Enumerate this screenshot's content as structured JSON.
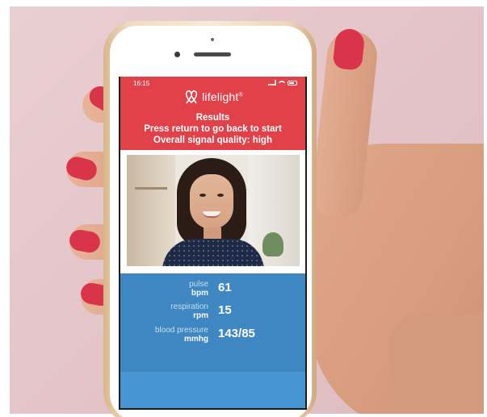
{
  "status_bar": {
    "time": "16:15"
  },
  "brand": {
    "name": "lifelight",
    "mark": "®",
    "logo_icon": "heart-loop-icon"
  },
  "header": {
    "title": "Results",
    "instruction": "Press return to go back to start",
    "signal_quality": "Overall signal quality: high"
  },
  "metrics": [
    {
      "label": "pulse",
      "unit": "bpm",
      "value": "61"
    },
    {
      "label": "respiration",
      "unit": "rpm",
      "value": "15"
    },
    {
      "label": "blood pressure",
      "unit": "mmhg",
      "value": "143/85"
    }
  ],
  "colors": {
    "header_red": "#e1424a",
    "results_blue": "#3f87c3",
    "nail_red": "#d9344a"
  }
}
